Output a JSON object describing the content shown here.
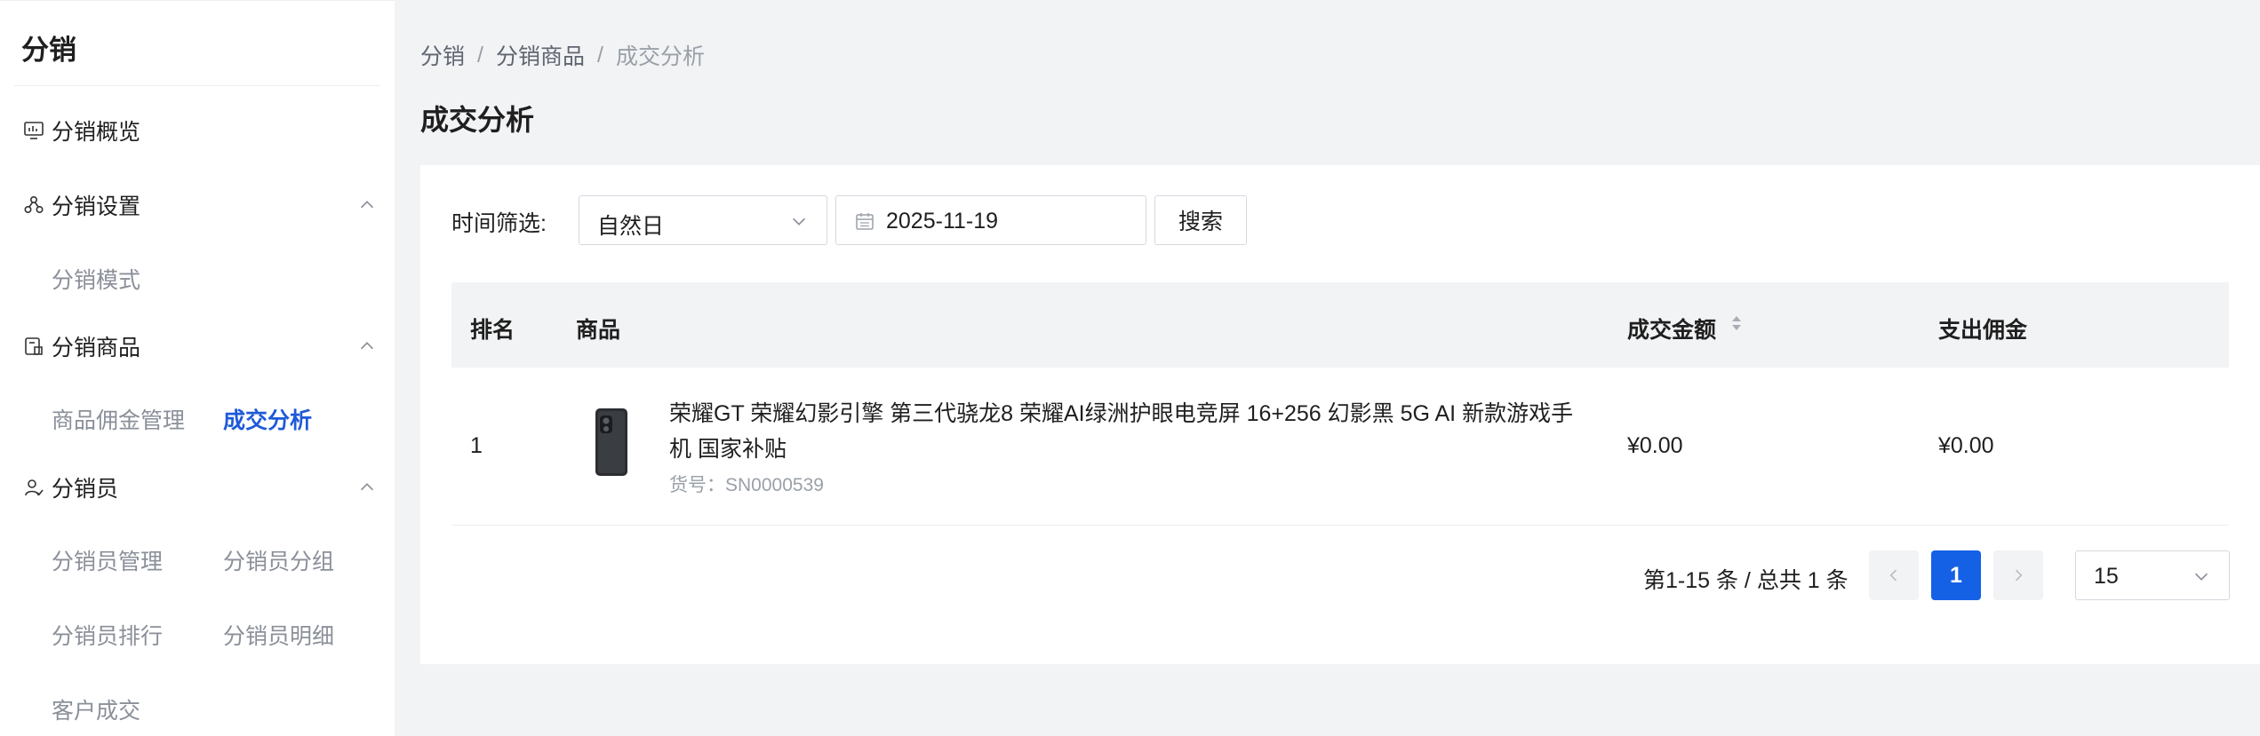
{
  "sidebar": {
    "title": "分销",
    "menu": [
      {
        "label": "分销概览",
        "icon": "monitor-chart-icon"
      },
      {
        "label": "分销设置",
        "icon": "nodes-icon",
        "expanded": true,
        "children": [
          "分销模式"
        ]
      },
      {
        "label": "分销商品",
        "icon": "product-tag-icon",
        "expanded": true,
        "children": [
          "商品佣金管理",
          "成交分析"
        ],
        "active_child": "成交分析"
      },
      {
        "label": "分销员",
        "icon": "user-icon",
        "expanded": true,
        "children": [
          "分销员管理",
          "分销员分组",
          "分销员排行",
          "分销员明细",
          "客户成交"
        ]
      }
    ]
  },
  "breadcrumb": {
    "items": [
      "分销",
      "分销商品",
      "成交分析"
    ],
    "separator": "/"
  },
  "page_title": "成交分析",
  "filter": {
    "label": "时间筛选:",
    "period_select": "自然日",
    "date": "2025-11-19",
    "search_label": "搜索"
  },
  "table": {
    "columns": [
      "排名",
      "商品",
      "成交金额",
      "支出佣金"
    ],
    "rows": [
      {
        "rank": "1",
        "product_name": "荣耀GT 荣耀幻影引擎 第三代骁龙8 荣耀AI绿洲护眼电竞屏 16+256 幻影黑 5G AI 新款游戏手机 国家补贴",
        "sku": "货号：SN0000539",
        "amount": "¥0.00",
        "commission": "¥0.00"
      }
    ]
  },
  "pagination": {
    "total_text": "第1-15 条 / 总共 1 条",
    "current_page": "1",
    "page_size": "15"
  },
  "colors": {
    "accent": "#1461e6",
    "active_link": "#1f5ad8"
  }
}
